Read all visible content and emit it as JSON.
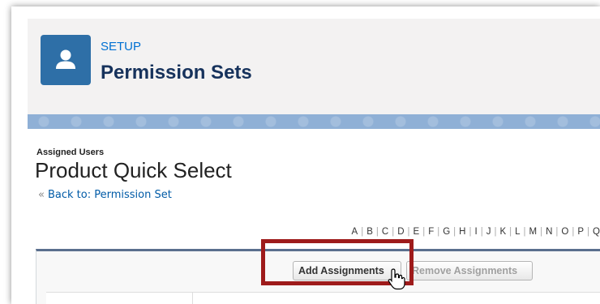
{
  "header": {
    "breadcrumb": "SETUP",
    "title": "Permission Sets",
    "icon": "user-icon"
  },
  "page": {
    "section_label": "Assigned Users",
    "name": "Product Quick Select",
    "back_link": "Back to: Permission Set",
    "back_arrow": "«"
  },
  "alphabet": [
    "A",
    "B",
    "C",
    "D",
    "E",
    "F",
    "G",
    "H",
    "I",
    "J",
    "K",
    "L",
    "M",
    "N",
    "O",
    "P",
    "Q"
  ],
  "toolbar": {
    "add_label": "Add Assignments",
    "remove_label": "Remove Assignments"
  },
  "colors": {
    "brand_icon": "#2e6fa7",
    "link": "#015ba7",
    "highlight_box": "#9e1b1b"
  }
}
